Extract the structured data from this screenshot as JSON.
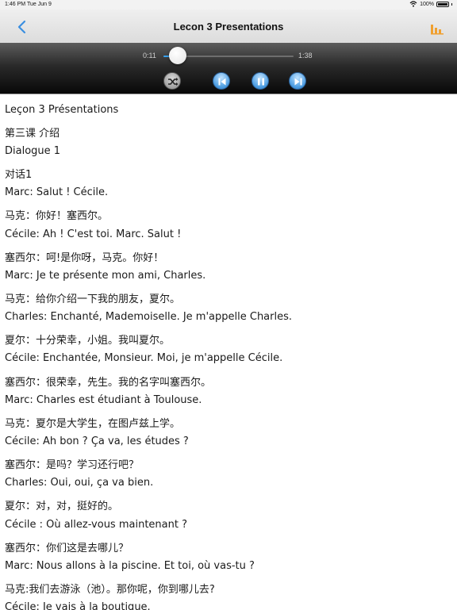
{
  "status_bar": {
    "time": "1:46 PM",
    "date": "Tue Jun 9",
    "battery": "100%"
  },
  "nav": {
    "title": "Lecon 3 Presentations"
  },
  "player": {
    "current_time": "0:11",
    "total_time": "1:38",
    "progress": 0.112
  },
  "icons": {
    "back": "chevron-left-icon",
    "chart": "bar-chart-icon",
    "shuffle": "shuffle-icon",
    "prev": "skip-previous-icon",
    "pause": "pause-icon",
    "next": "skip-next-icon"
  },
  "colors": {
    "accent": "#37a2f0",
    "chart_icon": "#f0a030"
  },
  "lines": [
    "Leçon 3 Présentations",
    "第三课 介绍",
    "Dialogue 1",
    "对话1",
    "Marc: Salut ! Cécile.",
    "马克：你好！塞西尔。",
    "Cécile: Ah ! C'est toi. Marc. Salut !",
    "塞西尔：呵!是你呀，马克。你好！",
    "Marc: Je te présente mon ami, Charles.",
    "马克：给你介绍一下我的朋友，夏尔。",
    "Charles: Enchanté, Mademoiselle. Je m'appelle Charles.",
    "夏尔：十分荣幸，小姐。我叫夏尔。",
    "Cécile: Enchantée, Monsieur. Moi, je m'appelle Cécile.",
    "塞西尔：很荣幸，先生。我的名字叫塞西尔。",
    "Marc: Charles est étudiant à Toulouse.",
    "马克：夏尔是大学生，在图卢兹上学。",
    "Cécile: Ah bon ? Ça va, les études ?",
    "塞西尔：是吗？学习还行吧？",
    "Charles: Oui, oui, ça va bien.",
    "夏尔：对，对，挺好的。",
    "Cécile : Où allez-vous maintenant ?",
    "塞西尔：你们这是去哪儿？",
    "Marc: Nous allons à la piscine. Et toi, où vas-tu ?",
    "马克:我们去游泳（池）。那你呢，你到哪儿去?",
    "Cécile: Je vais à la boutique."
  ]
}
